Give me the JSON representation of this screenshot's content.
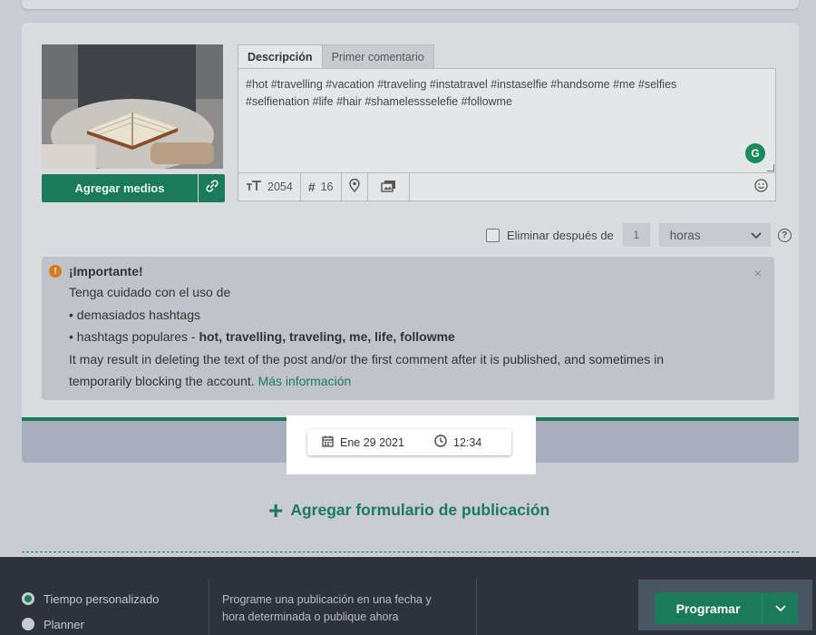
{
  "editor": {
    "tabs": [
      {
        "label": "Descripción",
        "active": true
      },
      {
        "label": "Primer comentario",
        "active": false
      }
    ],
    "text_line1": "#hot #travelling #vacation #traveling #instatravel #instaselfie #handsome #me #selfies",
    "text_line2": "#selfienation #life #hair #shamelessselefie #followme",
    "grammarly_glyph": "G",
    "toolbar": {
      "text_size_icon": "text-size-icon",
      "char_count": "2054",
      "hash_glyph": "#",
      "hashtag_count": "16",
      "location_icon": "location-pin-icon",
      "gallery_icon": "gallery-icon",
      "emoji_icon": "emoji-icon"
    }
  },
  "media": {
    "add_label": "Agregar medios",
    "link_icon": "link-icon"
  },
  "delete_after": {
    "label": "Eliminar después de",
    "value": "1",
    "unit": "horas",
    "help": "?"
  },
  "alert": {
    "title": "¡Importante!",
    "line1": "Tenga cuidado con el uso de",
    "line2": "• demasiados hashtags",
    "line3_prefix": "• hashtags populares - ",
    "line3_bold": "hot, travelling, traveling, me, life, followme",
    "line4": "It may result in deleting the text of the post and/or the first comment after it is published, and sometimes in",
    "line5": "temporarily blocking the account. ",
    "link": "Más información",
    "warn_glyph": "!",
    "close": "×"
  },
  "schedule": {
    "date": "Ene 29 2021",
    "time": "12:34"
  },
  "add_form": {
    "plus": "+",
    "label": "Agregar formulario de publicación"
  },
  "footer": {
    "options": [
      {
        "label": "Tiempo personalizado",
        "checked": true
      },
      {
        "label": "Planner",
        "checked": false
      }
    ],
    "description_line1": "Programe una publicación en una fecha y",
    "description_line2": "hora determinada o publique ahora",
    "button_label": "Programar"
  },
  "colors": {
    "accent": "#1b7a5a",
    "warning": "#d97a1d",
    "footer_bg": "#2d333d"
  }
}
